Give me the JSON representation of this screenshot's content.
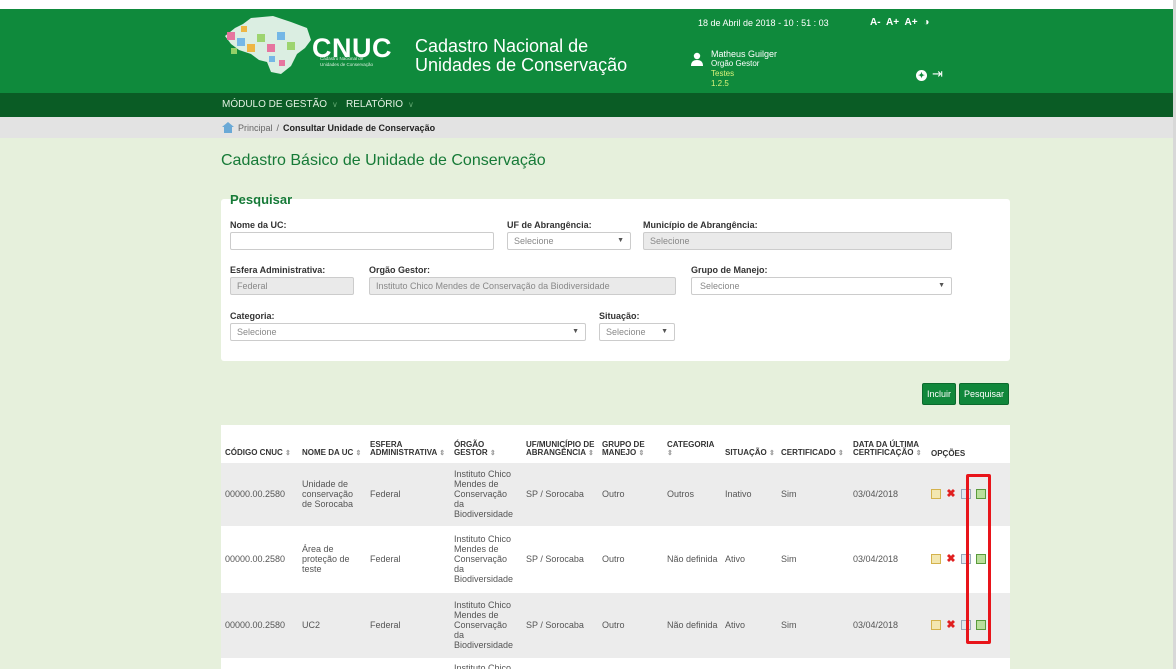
{
  "header": {
    "logo_text": "CNUC",
    "logo_subtitle": "Cadastro Nacional de Unidades de Conservação",
    "app_title": "Cadastro Nacional de Unidades de Conservação",
    "datetime": "18 de Abril de 2018 - 10 : 51 : 03",
    "font_tools": [
      "A-",
      "A+",
      "A+"
    ],
    "contrast_icon": "contrast-icon",
    "user": {
      "name": "Matheus Guilger",
      "role": "Orgão Gestor",
      "environment": "Testes",
      "version": "1.2.5"
    }
  },
  "nav": {
    "items": [
      {
        "label": "MÓDULO DE GESTÃO"
      },
      {
        "label": "RELATÓRIO"
      }
    ]
  },
  "breadcrumb": {
    "home": "Principal",
    "separator": "/",
    "current": "Consultar Unidade de Conservação"
  },
  "page_title": "Cadastro Básico de Unidade de Conservação",
  "search": {
    "legend": "Pesquisar",
    "nome_uc_label": "Nome da UC:",
    "nome_uc_value": "",
    "uf_label": "UF de Abrangência:",
    "uf_value": "Selecione",
    "municipio_label": "Município de Abrangência:",
    "municipio_value": "Selecione",
    "esfera_label": "Esfera Administrativa:",
    "esfera_value": "Federal",
    "orgao_label": "Orgão Gestor:",
    "orgao_value": "Instituto Chico Mendes de Conservação da Biodiversidade",
    "grupo_label": "Grupo de Manejo:",
    "grupo_value": "Selecione",
    "categoria_label": "Categoria:",
    "categoria_value": "Selecione",
    "situacao_label": "Situação:",
    "situacao_value": "Selecione"
  },
  "buttons": {
    "incluir": "Incluir",
    "pesquisar": "Pesquisar"
  },
  "table": {
    "columns": [
      "CÓDIGO CNUC",
      "NOME DA UC",
      "ESFERA ADMINISTRATIVA",
      "ÓRGÃO GESTOR",
      "UF/MUNICÍPIO DE ABRANGÊNCIA",
      "GRUPO DE MANEJO",
      "CATEGORIA",
      "SITUAÇÃO",
      "CERTIFICADO",
      "DATA DA ÚLTIMA CERTIFICAÇÃO",
      "OPÇÕES"
    ],
    "rows": [
      {
        "codigo": "00000.00.2580",
        "nome": "Unidade de conservação de Sorocaba",
        "esfera": "Federal",
        "orgao": "Instituto Chico Mendes de Conservação da Biodiversidade",
        "uf": "SP / Sorocaba",
        "grupo": "Outro",
        "categoria": "Outros",
        "situacao": "Inativo",
        "certificado": "Sim",
        "data": "03/04/2018"
      },
      {
        "codigo": "00000.00.2580",
        "nome": "Área de proteção de teste",
        "esfera": "Federal",
        "orgao": "Instituto Chico Mendes de Conservação da Biodiversidade",
        "uf": "SP / Sorocaba",
        "grupo": "Outro",
        "categoria": "Não definida",
        "situacao": "Ativo",
        "certificado": "Sim",
        "data": "03/04/2018"
      },
      {
        "codigo": "00000.00.2580",
        "nome": "UC2",
        "esfera": "Federal",
        "orgao": "Instituto Chico Mendes de Conservação da Biodiversidade",
        "uf": "SP / Sorocaba",
        "grupo": "Outro",
        "categoria": "Não definida",
        "situacao": "Ativo",
        "certificado": "Sim",
        "data": "03/04/2018"
      },
      {
        "orgao": "Instituto Chico"
      }
    ]
  },
  "colors": {
    "header_green": "#0f8a3c",
    "nav_green": "#0a5c25",
    "background": "#e6f0dc",
    "title_green": "#167a37",
    "highlight_red": "#e8141a"
  }
}
